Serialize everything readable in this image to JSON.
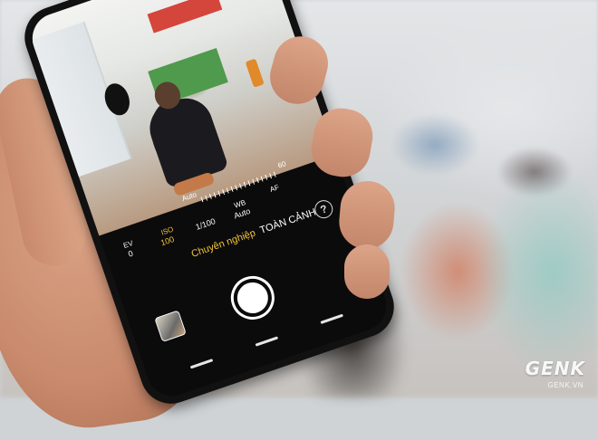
{
  "camera": {
    "mode_active": "Chuyên nghiệp",
    "mode_next": "TOÀN CẢNH",
    "help_symbol": "?",
    "shutter_icon": "shutter-icon",
    "gallery_icon": "gallery-thumbnail-icon"
  },
  "pro_controls": {
    "shutter_auto": "Auto",
    "shutter_tick": "60",
    "ev_label": "EV",
    "ev_value": "0",
    "iso_label": "ISO",
    "iso_value": "100",
    "speed_value": "1/100",
    "wb_label": "WB",
    "wb_value": "Auto",
    "af_label": "AF"
  },
  "watermark": {
    "brand": "GENK",
    "url": "GENK.VN"
  },
  "colors": {
    "mode_active": "#f2c43a",
    "screen_bg": "#0b0b0c"
  }
}
